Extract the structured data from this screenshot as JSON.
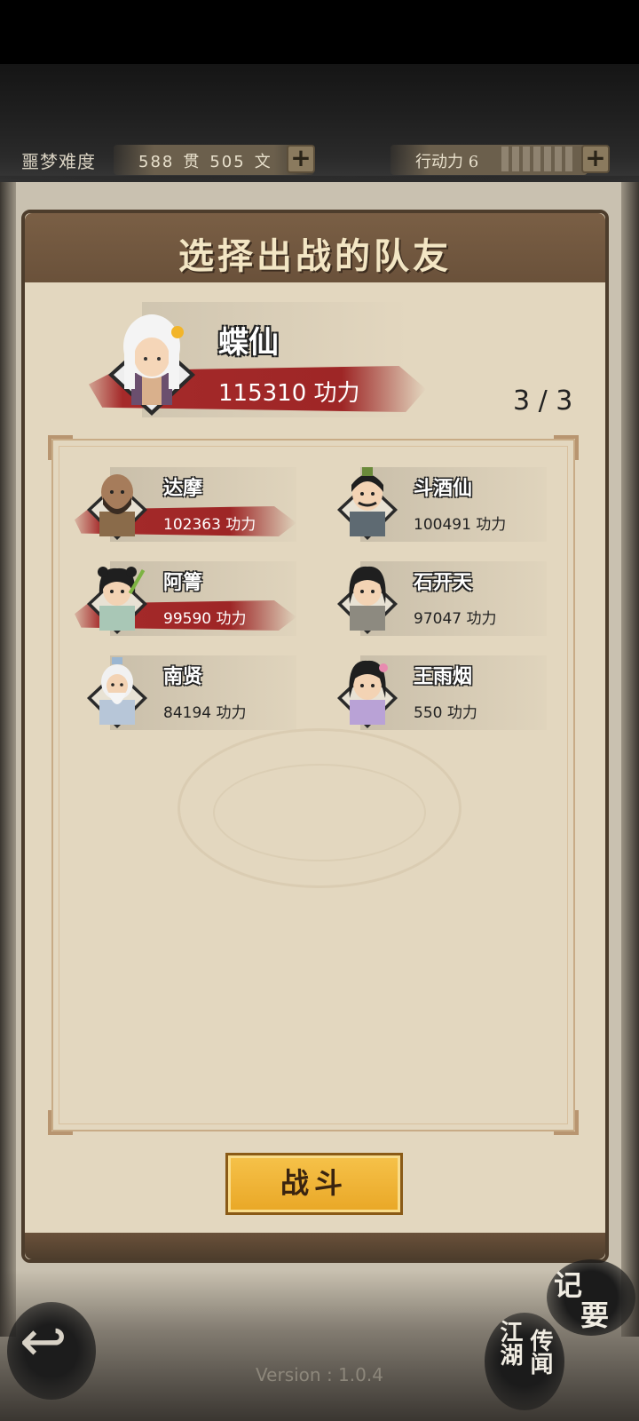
{
  "header": {
    "difficulty": "噩梦难度",
    "money_guan": "588",
    "money_guan_unit": "贯",
    "money_wen": "505",
    "money_wen_unit": "文",
    "stamina_label": "行动力 6",
    "stamina_pips": 7,
    "plus_symbol": "+"
  },
  "panel": {
    "title": "选择出战的队友"
  },
  "leader": {
    "name": "蝶仙",
    "power": "115310 功力",
    "team_count": "3 / 3"
  },
  "members": [
    {
      "name": "达摩",
      "power": "102363 功力",
      "selected": true
    },
    {
      "name": "斗酒仙",
      "power": "100491 功力",
      "selected": false
    },
    {
      "name": "阿箐",
      "power": "99590 功力",
      "selected": true
    },
    {
      "name": "石开天",
      "power": "97047 功力",
      "selected": false
    },
    {
      "name": "南贤",
      "power": "84194 功力",
      "selected": false
    },
    {
      "name": "王雨烟",
      "power": "550 功力",
      "selected": false
    }
  ],
  "fight_button": "战斗",
  "bottom": {
    "notes_1": "记",
    "notes_2": "要",
    "legend_col1": "江湖",
    "legend_col2": "传闻",
    "back_arrow": "↩",
    "version": "Version : 1.0.4"
  },
  "colors": {
    "accent_red": "#a52a2a",
    "panel_brown": "#6a513a",
    "parchment": "#e3d7bf",
    "button_gold": "#f6c24a"
  }
}
